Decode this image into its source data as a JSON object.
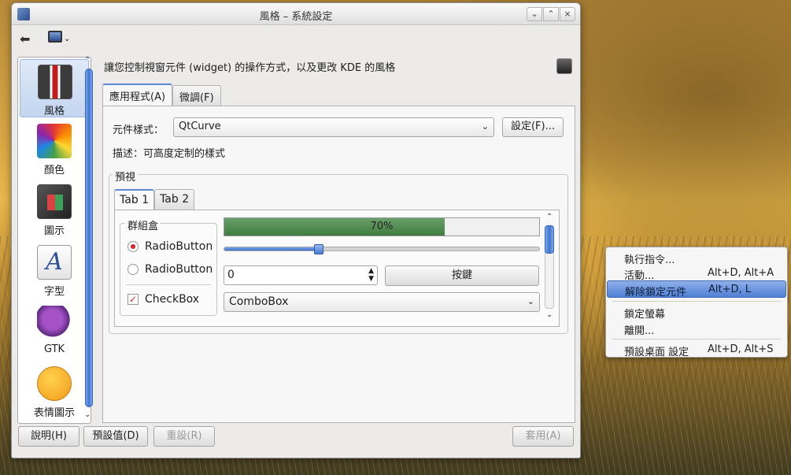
{
  "window": {
    "title": "風格  –  系統設定",
    "buttons": [
      "⌄",
      "⌃",
      "×"
    ]
  },
  "sidebar": {
    "items": [
      {
        "label": "風格",
        "icon": "suit-icon"
      },
      {
        "label": "顏色",
        "icon": "color-wheel-icon"
      },
      {
        "label": "圖示",
        "icon": "icon-cube-icon"
      },
      {
        "label": "字型",
        "icon": "font-icon"
      },
      {
        "label": "GTK",
        "icon": "gtk-icon"
      },
      {
        "label": "表情圖示",
        "icon": "smiley-icon"
      }
    ]
  },
  "main": {
    "description_header": "讓您控制視窗元件 (widget) 的操作方式，以及更改 KDE 的風格",
    "tabs": [
      "應用程式(A)",
      "微調(F)"
    ],
    "widget_style_label": "元件樣式：",
    "widget_style_value": "QtCurve",
    "config_button": "設定(F)...",
    "description": "描述：可高度定制的樣式",
    "preview_label": "預視",
    "preview_tabs": [
      "Tab 1",
      "Tab 2"
    ],
    "groupbox_title": "群組盒",
    "radio1": "RadioButton",
    "radio2": "RadioButton",
    "checkbox": "CheckBox",
    "progress_text": "70%",
    "progress_value": 0.7,
    "slider_value": 0.3,
    "spin_value": "0",
    "push_button": "按鍵",
    "combobox": "ComboBox"
  },
  "footer": {
    "help": "說明(H)",
    "defaults": "預設值(D)",
    "reset": "重設(R)",
    "apply": "套用(A)"
  },
  "context_menu": {
    "items": [
      {
        "label": "執行指令...",
        "shortcut": ""
      },
      {
        "label": "活動...",
        "shortcut": "Alt+D, Alt+A"
      },
      {
        "label": "解除鎖定元件",
        "shortcut": "Alt+D, L"
      },
      {
        "label": "鎖定螢幕",
        "shortcut": ""
      },
      {
        "label": "離開...",
        "shortcut": ""
      },
      {
        "label": "預設桌面 設定",
        "shortcut": "Alt+D, Alt+S"
      }
    ]
  }
}
